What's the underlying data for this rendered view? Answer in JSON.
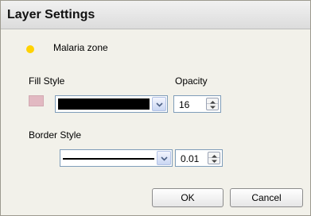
{
  "dialog": {
    "title": "Layer Settings"
  },
  "legend": {
    "label": "Malaria zone",
    "dot_color": "#ffd200"
  },
  "fill": {
    "label": "Fill Style",
    "swatch_color": "#e2b9c2",
    "selected_style": "solid black"
  },
  "opacity": {
    "label": "Opacity",
    "value": "16"
  },
  "border": {
    "label": "Border Style",
    "selected_style": "solid line",
    "width_value": "0.01"
  },
  "buttons": {
    "ok_label": "OK",
    "cancel_label": "Cancel"
  }
}
